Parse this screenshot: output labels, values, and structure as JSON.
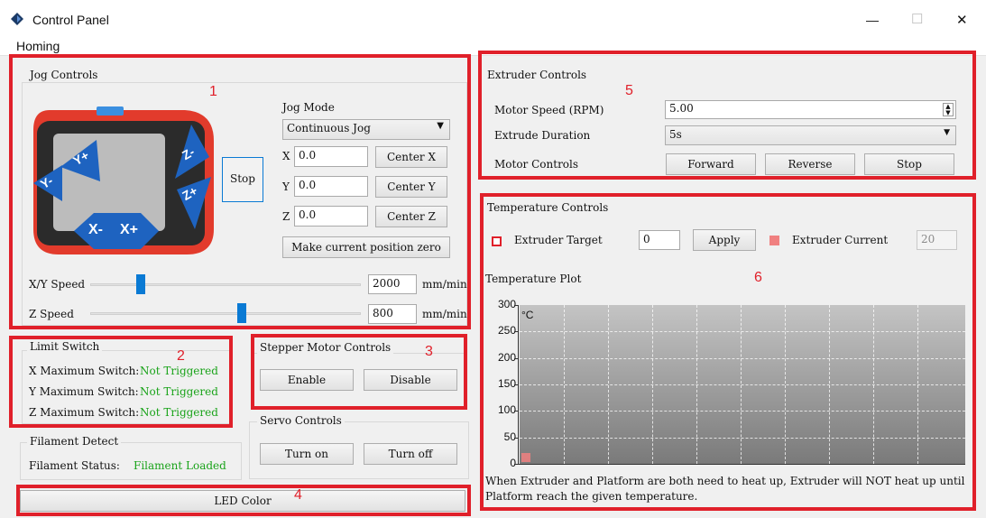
{
  "window": {
    "title": "Control Panel",
    "minimize": "—",
    "maximize": "☐",
    "close": "✕"
  },
  "menu": {
    "homing": "Homing"
  },
  "jog": {
    "title": "Jog Controls",
    "mode_label": "Jog Mode",
    "mode_value": "Continuous Jog",
    "stop": "Stop",
    "x_label": "X",
    "x_value": "0.0",
    "center_x": "Center X",
    "y_label": "Y",
    "y_value": "0.0",
    "center_y": "Center Y",
    "z_label": "Z",
    "z_value": "0.0",
    "center_z": "Center Z",
    "zero": "Make current position zero",
    "xy_speed_label": "X/Y Speed",
    "xy_speed_value": "2000",
    "xy_speed_fraction": 0.186,
    "z_speed_label": "Z Speed",
    "z_speed_value": "800",
    "z_speed_fraction": 0.56,
    "unit": "mm/min",
    "pad": {
      "y_minus": "Y-",
      "y_plus": "Y+",
      "z_minus": "Z-",
      "z_plus": "Z+",
      "x_minus": "X-",
      "x_plus": "X+"
    }
  },
  "limit": {
    "title": "Limit Switch",
    "x_label": "X Maximum Switch:",
    "x_state": "Not Triggered",
    "y_label": "Y Maximum Switch:",
    "y_state": "Not Triggered",
    "z_label": "Z Maximum Switch:",
    "z_state": "Not Triggered"
  },
  "stepper": {
    "title": "Stepper Motor Controls",
    "enable": "Enable",
    "disable": "Disable"
  },
  "servo": {
    "title": "Servo Controls",
    "on": "Turn on",
    "off": "Turn off"
  },
  "filament": {
    "title": "Filament Detect",
    "label": "Filament Status:",
    "state": "Filament Loaded"
  },
  "led": {
    "label": "LED Color"
  },
  "extruder": {
    "title": "Extruder Controls",
    "speed_label": "Motor Speed (RPM)",
    "speed_value": "5.00",
    "duration_label": "Extrude Duration",
    "duration_value": "5s",
    "motor_label": "Motor Controls",
    "forward": "Forward",
    "reverse": "Reverse",
    "stop": "Stop"
  },
  "temperature": {
    "title": "Temperature Controls",
    "target_label": "Extruder Target",
    "target_value": "0",
    "apply": "Apply",
    "current_label": "Extruder Current",
    "current_value": "20",
    "plot_label": "Temperature Plot",
    "unit": "°C",
    "note": "When Extruder and Platform are both need to heat up, Extruder will NOT heat up until Platform reach the given temperature."
  },
  "annotations": {
    "n1": "1",
    "n2": "2",
    "n3": "3",
    "n4": "4",
    "n5": "5",
    "n6": "6"
  },
  "colors": {
    "accent": "#0a7ad4",
    "annotation": "#e0202a",
    "status_ok": "#1aa31a",
    "target_marker": "#e0202a",
    "current_marker": "#f08080"
  },
  "chart_data": {
    "type": "line",
    "title": "Temperature Plot",
    "ylabel": "°C",
    "ylim": [
      0,
      300
    ],
    "yticks": [
      0,
      50,
      100,
      150,
      200,
      250,
      300
    ],
    "series": [],
    "grid": true
  }
}
